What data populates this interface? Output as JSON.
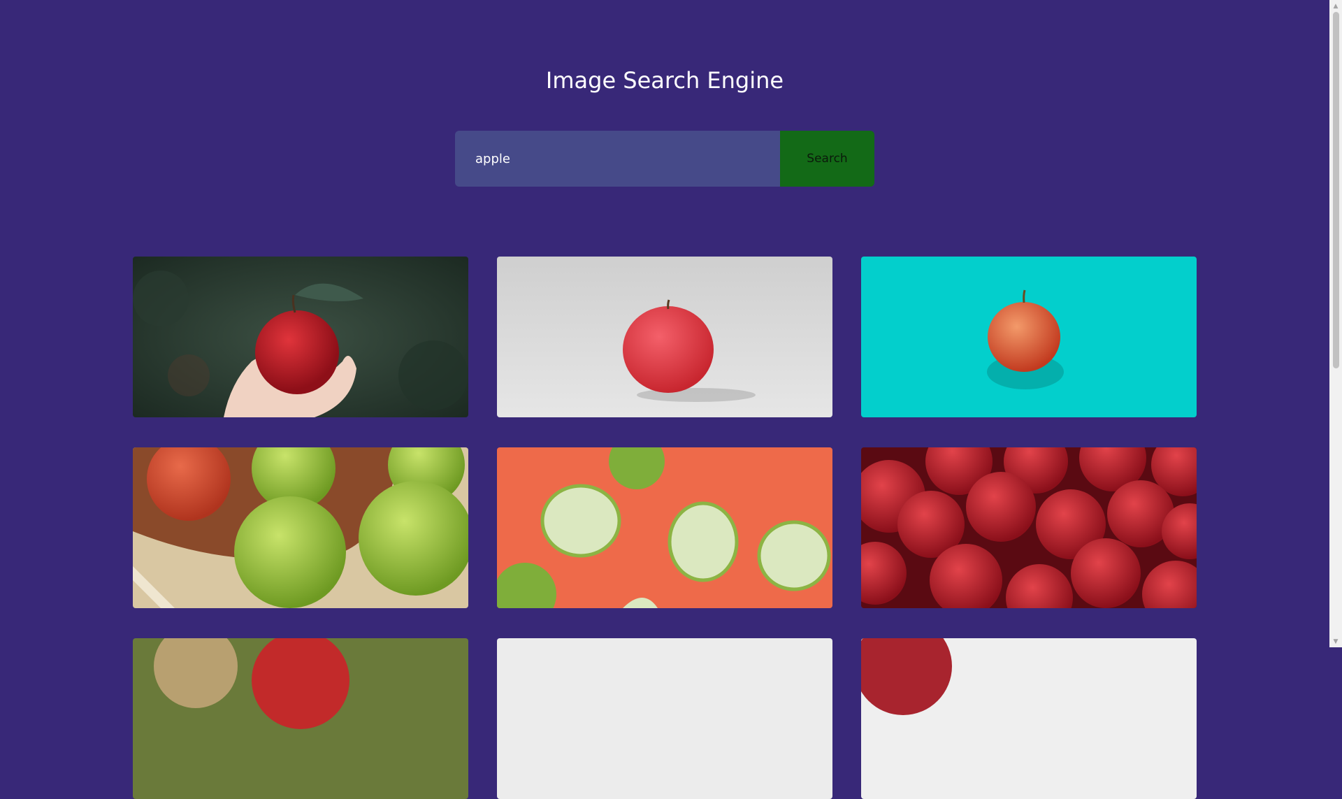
{
  "header": {
    "title": "Image Search Engine"
  },
  "search": {
    "value": "apple",
    "button_label": "Search"
  },
  "results": [
    {
      "subject": "red apple held in hand, green foliage background"
    },
    {
      "subject": "red apple on light grey backdrop"
    },
    {
      "subject": "red apple on turquoise background"
    },
    {
      "subject": "green apples in wooden bowl"
    },
    {
      "subject": "sliced green apples on orange background"
    },
    {
      "subject": "pile of red apples"
    },
    {
      "subject": "partially visible result"
    },
    {
      "subject": "partially visible result"
    },
    {
      "subject": "partially visible result"
    }
  ],
  "colors": {
    "background": "#382878",
    "input_bg": "#464a89",
    "button_bg": "#136a17"
  },
  "scrollbar": {
    "up": "scroll-up-arrow",
    "down": "scroll-down-arrow"
  }
}
